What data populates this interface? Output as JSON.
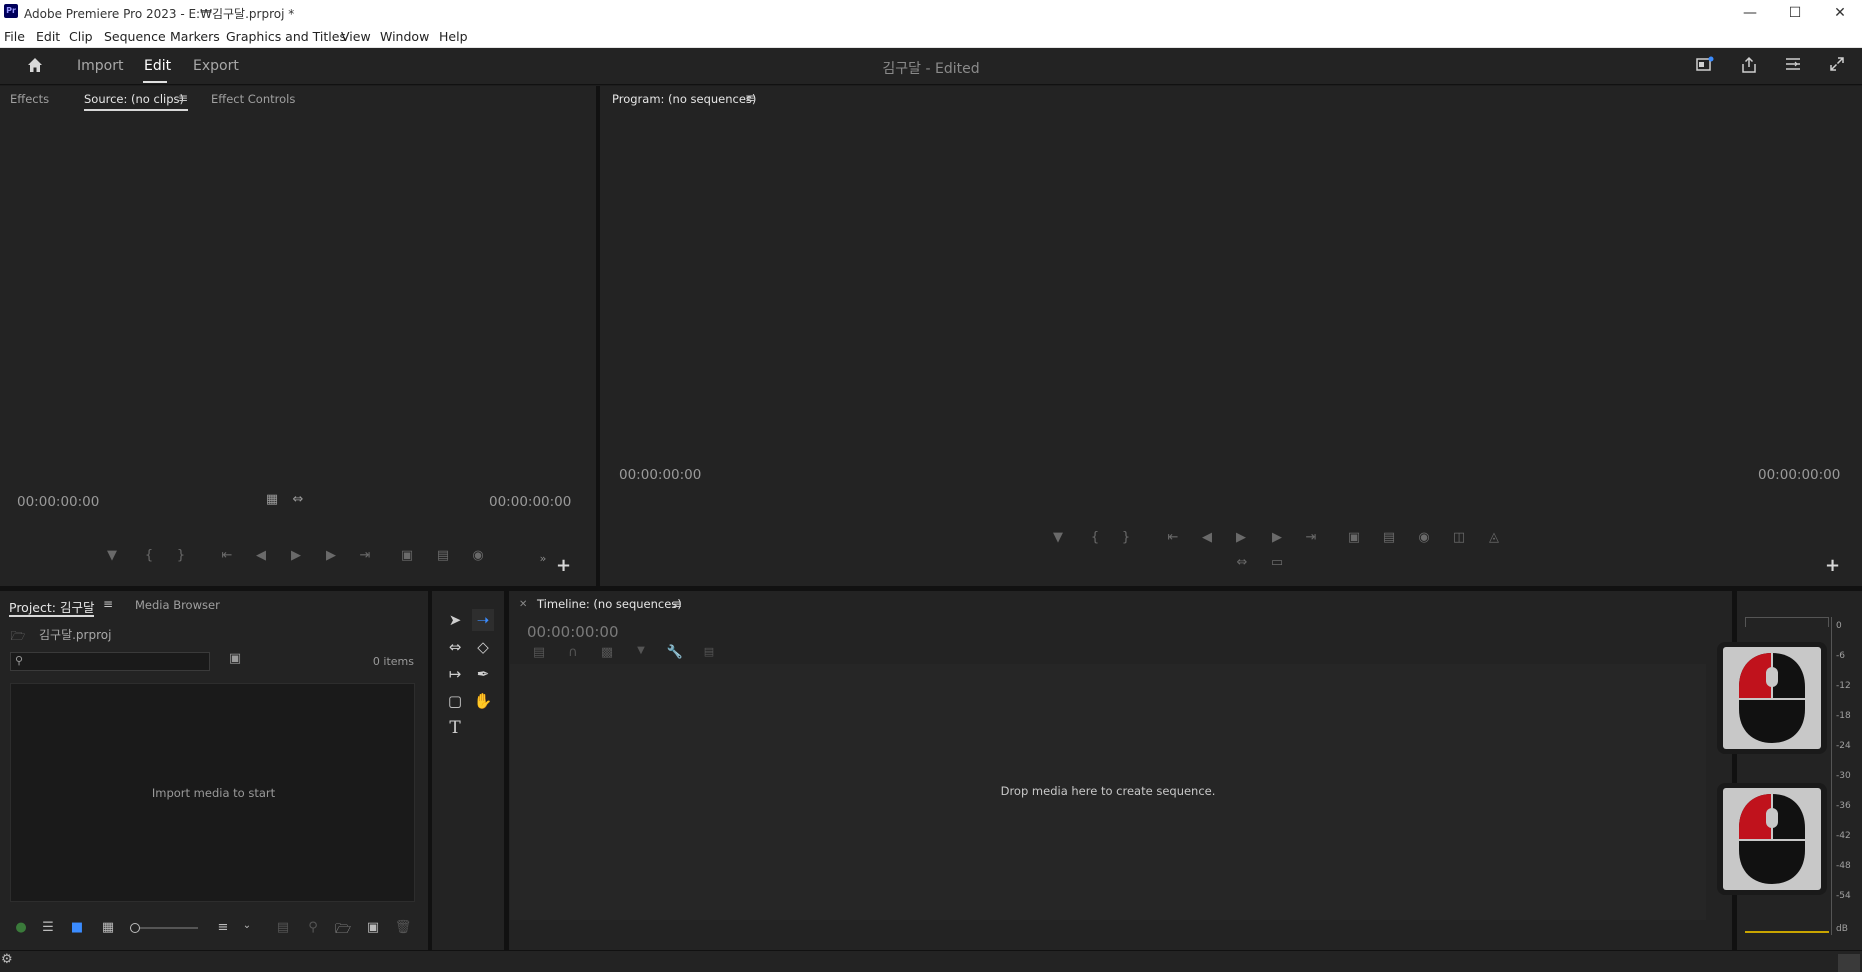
{
  "window": {
    "app_logo": "Pr",
    "title": "Adobe Premiere Pro 2023 - E:₩김구달.prproj *",
    "controls": [
      "minimize-icon",
      "maximize-icon",
      "close-icon"
    ]
  },
  "menubar": {
    "items": [
      "File",
      "Edit",
      "Clip",
      "Sequence",
      "Markers",
      "Graphics and Titles",
      "View",
      "Window",
      "Help"
    ]
  },
  "header": {
    "tabs": [
      "Import",
      "Edit",
      "Export"
    ],
    "active_tab": "Edit",
    "project_name": "김구달",
    "project_status": "- Edited",
    "icons": [
      "home-icon",
      "quick-export-icon",
      "share-icon",
      "workspace-menu-icon",
      "fullscreen-icon"
    ]
  },
  "source_panel": {
    "tabs": [
      "Effects",
      "Source: (no clips)",
      "Effect Controls"
    ],
    "active_tab": "Source: (no clips)",
    "timecode_left": "00:00:00:00",
    "timecode_right": "00:00:00:00"
  },
  "program_panel": {
    "title": "Program: (no sequences)",
    "timecode_left": "00:00:00:00",
    "timecode_right": "00:00:00:00"
  },
  "project_panel": {
    "tabs": [
      "Project: 김구달",
      "Media Browser"
    ],
    "active_tab": "Project: 김구달",
    "file_name": "김구달.prproj",
    "search_placeholder": "",
    "items_count": "0 items",
    "empty_message": "Import media to start"
  },
  "timeline_panel": {
    "title": "Timeline: (no sequences)",
    "timecode": "00:00:00:00",
    "empty_message": "Drop media here to create sequence."
  },
  "audio_meter": {
    "scale": [
      "0",
      "-6",
      "-12",
      "-18",
      "-24",
      "-30",
      "-36",
      "-42",
      "-48",
      "-54",
      "dB"
    ]
  },
  "colors": {
    "accent_blue": "#3b8cff",
    "panel_bg": "#232323",
    "mouse_red": "#c0121c"
  }
}
